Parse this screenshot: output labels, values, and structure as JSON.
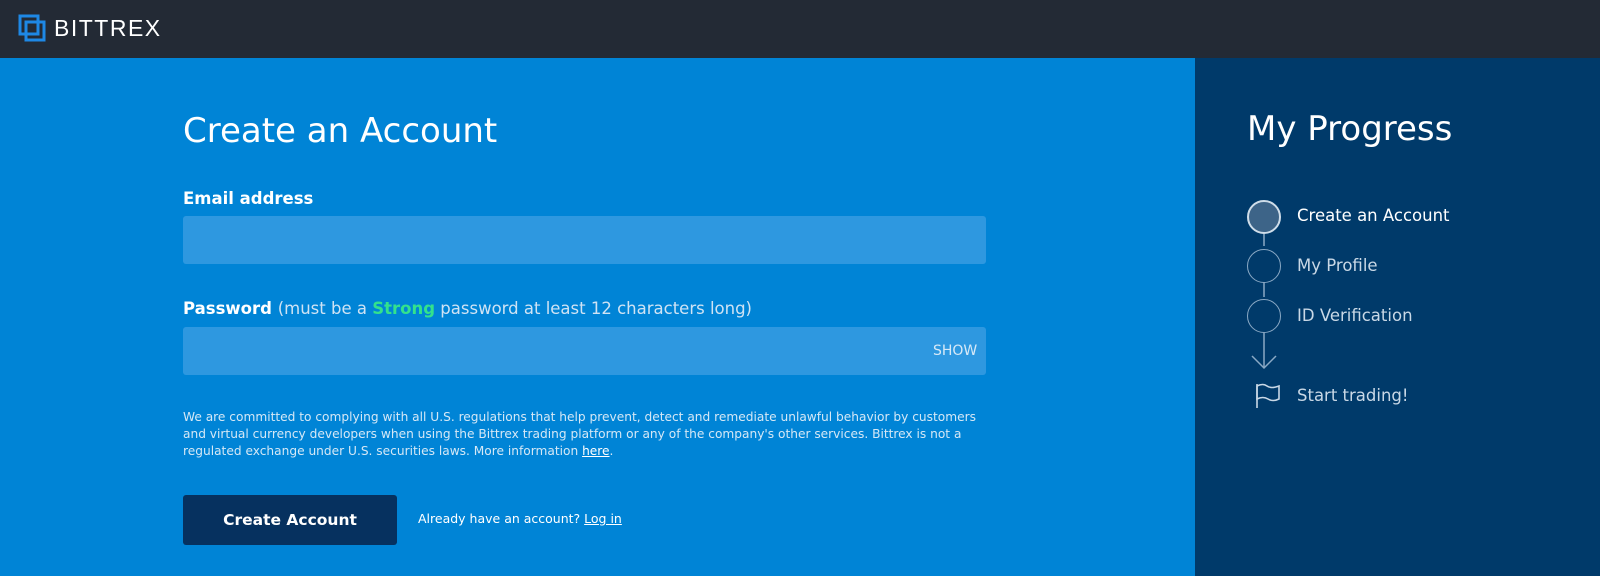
{
  "brand": {
    "name": "BITTREX",
    "accent": "#1e88e5"
  },
  "form": {
    "title": "Create an Account",
    "email_label": "Email address",
    "email_value": "",
    "password_label": "Password",
    "password_hint_prefix": "(must be a ",
    "password_hint_strong": "Strong",
    "password_hint_suffix": " password at least 12 characters long)",
    "password_value": "",
    "show_label": "SHOW",
    "disclaimer_text": "We are committed to complying with all U.S. regulations that help prevent, detect and remediate unlawful behavior by customers and virtual currency developers when using the Bittrex trading platform or any of the company's other services. Bittrex is not a regulated exchange under U.S. securities laws. More information ",
    "disclaimer_link": "here",
    "disclaimer_end": ".",
    "submit_label": "Create Account",
    "login_prompt": "Already have an account? ",
    "login_link": "Log in"
  },
  "progress": {
    "title": "My Progress",
    "steps": [
      {
        "label": "Create an Account",
        "state": "active"
      },
      {
        "label": "My Profile",
        "state": "pending"
      },
      {
        "label": "ID Verification",
        "state": "pending"
      }
    ],
    "final_step": {
      "label": "Start trading!",
      "icon": "flag-icon"
    }
  },
  "colors": {
    "topbar": "#232a35",
    "main_bg": "#0084d6",
    "sidebar_bg": "#003a6a",
    "strong_text": "#33e28c",
    "button_bg": "#06315f"
  }
}
